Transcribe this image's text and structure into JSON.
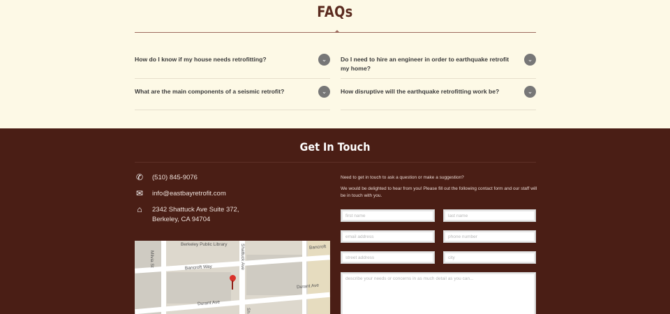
{
  "faq": {
    "title": "FAQs",
    "items": [
      {
        "question": "How do I know if my house needs retrofitting?"
      },
      {
        "question": "Do I need to hire an engineer in order to earthquake retrofit my home?"
      },
      {
        "question": "What are the main components of a seismic retrofit?"
      },
      {
        "question": "How disruptive will the earthquake retrofitting work be?"
      }
    ],
    "toggle_icon": "chevron-down-icon"
  },
  "contact": {
    "title": "Get In Touch",
    "phone": "(510) 845-9076",
    "email": "info@eastbayretrofit.com",
    "address": "2342 Shattuck Ave Suite 372,\nBerkeley, CA 94704",
    "icons": [
      "phone-icon",
      "envelope-icon",
      "home-icon"
    ],
    "map": {
      "labels": [
        "Berkeley Public Library",
        "Bancroft Way",
        "Bancroft",
        "Durant Ave",
        "Durant Ave",
        "Milvia St",
        "Shattuck Ave",
        "Sh"
      ]
    }
  },
  "form": {
    "intro_1": "Need to get in touch to ask a question or make a suggestion?",
    "intro_2": "We would be delighted to hear from you! Please fill out the following contact form and our staff will be in touch with you.",
    "first_name_placeholder": "first name",
    "last_name_placeholder": "last name",
    "email_placeholder": "email address",
    "phone_placeholder": "phone number",
    "street_placeholder": "street address",
    "city_placeholder": "city",
    "message_placeholder": "describe your needs or concerns in as much detail as you can..."
  }
}
